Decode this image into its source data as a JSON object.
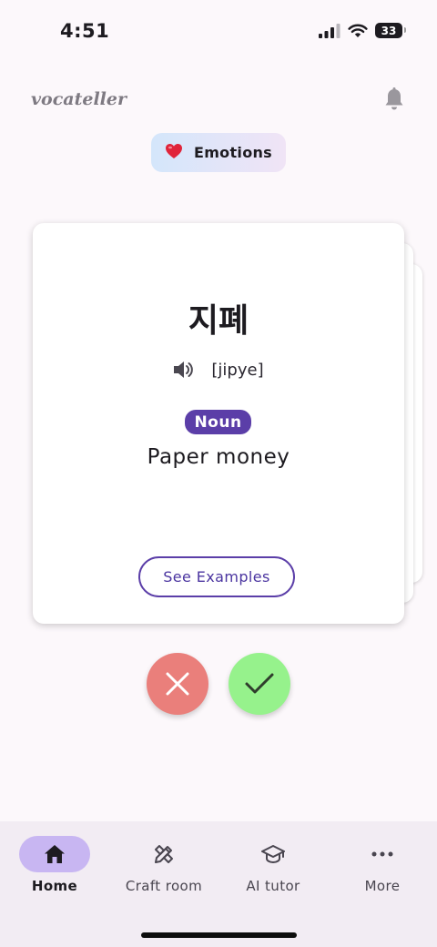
{
  "status": {
    "time": "4:51",
    "battery": "33"
  },
  "header": {
    "logo": "vocateller"
  },
  "category": {
    "emoji": "❤️",
    "label": "Emotions"
  },
  "card": {
    "word": "지폐",
    "pronunciation": "[jipye]",
    "part_of_speech": "Noun",
    "meaning": "Paper money",
    "examples_label": "See Examples"
  },
  "nav": {
    "items": [
      {
        "label": "Home",
        "icon": "home-icon",
        "active": true
      },
      {
        "label": "Craft room",
        "icon": "craft-icon",
        "active": false
      },
      {
        "label": "AI tutor",
        "icon": "graduation-cap-icon",
        "active": false
      },
      {
        "label": "More",
        "icon": "more-horizontal-icon",
        "active": false
      }
    ]
  },
  "colors": {
    "accent": "#5b3ea8",
    "reject": "#ea7f7b",
    "accept": "#96f28c",
    "nav_active": "#c8b6f2"
  }
}
